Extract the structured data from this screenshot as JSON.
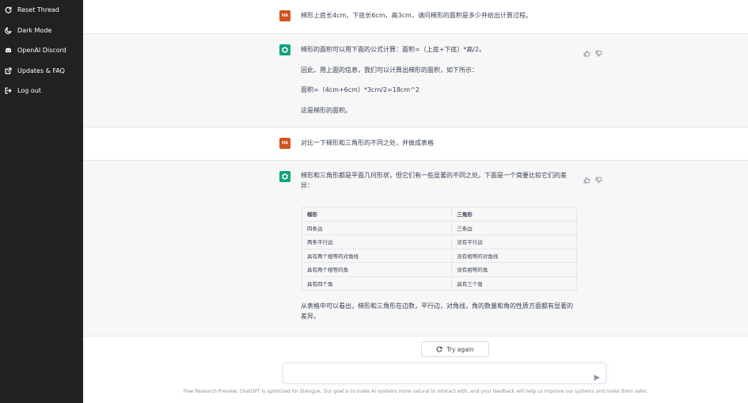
{
  "sidebar": {
    "items": [
      {
        "label": "Reset Thread",
        "icon": "refresh-icon"
      },
      {
        "label": "Dark Mode",
        "icon": "moon-icon"
      },
      {
        "label": "OpenAI Discord",
        "icon": "discord-icon"
      },
      {
        "label": "Updates & FAQ",
        "icon": "external-link-icon"
      },
      {
        "label": "Log out",
        "icon": "logout-icon"
      }
    ]
  },
  "conversation": {
    "user_avatar": "HA",
    "messages": [
      {
        "role": "user",
        "text": "梯形上底长4cm，下底长6cm，高3cm，请问梯形的面积是多少并给出计算过程。"
      },
      {
        "role": "assistant",
        "paragraphs": [
          "梯形的面积可以用下面的公式计算：面积=（上底+下底）*高/2。",
          "因此，用上面的信息，我们可以计算出梯形的面积，如下所示：",
          "面积=（4cm+6cm）*3cm/2=18cm^2",
          "这是梯形的面积。"
        ]
      },
      {
        "role": "user",
        "text": "对比一下梯形和三角形的不同之处，并做成表格"
      },
      {
        "role": "assistant",
        "intro": "梯形和三角形都是平面几何形状，但它们有一些显著的不同之处。下面是一个简要比较它们的差异：",
        "table": {
          "headers": [
            "梯形",
            "三角形"
          ],
          "rows": [
            [
              "四条边",
              "三条边"
            ],
            [
              "两条平行边",
              "没有平行边"
            ],
            [
              "具有两个相等的对角线",
              "没有相等的对角线"
            ],
            [
              "具有两个相等的角",
              "没有相等的角"
            ],
            [
              "具有四个角",
              "具有三个角"
            ]
          ]
        },
        "outro": "从表格中可以看出，梯形和三角形在边数，平行边，对角线，角的数量和角的性质方面都有显著的差异。"
      }
    ]
  },
  "controls": {
    "try_again_label": "Try again",
    "input_value": "",
    "footer": "Free Research Preview: ChatGPT is optimized for dialogue. Our goal is to make AI systems more natural to interact with, and your feedback will help us improve our systems and make them safer."
  },
  "colors": {
    "sidebar_bg": "#202123",
    "assistant_bg": "#f7f7f8",
    "user_avatar_bg": "#d4521e",
    "assistant_avatar_bg": "#10a37f"
  }
}
